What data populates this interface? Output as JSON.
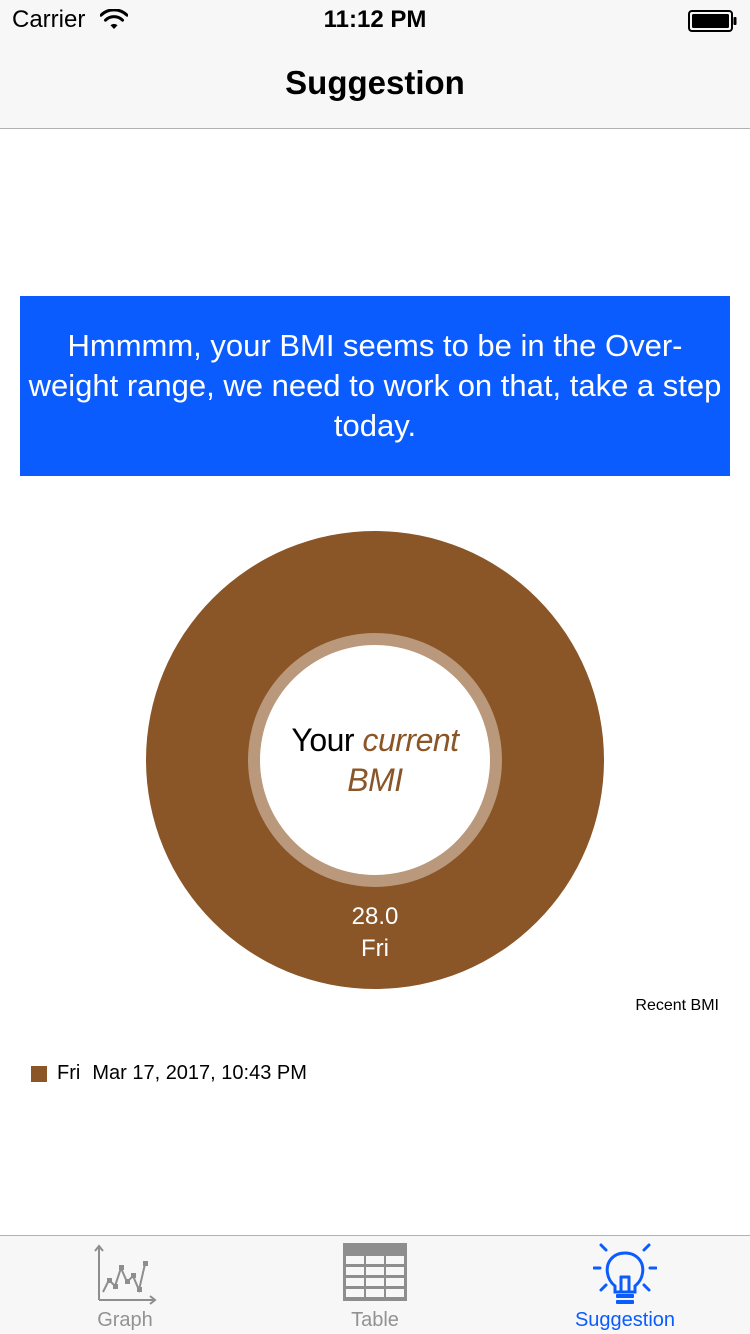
{
  "status_bar": {
    "carrier": "Carrier",
    "time": "11:12 PM",
    "icons": [
      "wifi-icon",
      "battery-icon"
    ]
  },
  "nav": {
    "title": "Suggestion"
  },
  "suggestion": {
    "message": "Hmmmm, your BMI seems to be in the Over-weight range, we need to work on that, take a step today.",
    "background_color": "#0b5cff"
  },
  "chart_data": {
    "type": "pie",
    "categories": [
      "Fri"
    ],
    "values": [
      28.0
    ],
    "value_labels": [
      "28.0"
    ],
    "center_text": {
      "prefix": "Your",
      "emphasis": "current",
      "suffix": "BMI"
    },
    "description": "Recent BMI",
    "legend": {
      "entries": [
        {
          "label": "Fri",
          "date": "Mar 17, 2017, 10:43 PM",
          "color": "#8a5527"
        }
      ],
      "position": "bottom-left"
    },
    "slice_color": "#8a5527",
    "hole_ring_color": "#b9987b"
  },
  "tabs": [
    {
      "label": "Graph",
      "icon": "line-graph-icon",
      "active": false
    },
    {
      "label": "Table",
      "icon": "table-grid-icon",
      "active": false
    },
    {
      "label": "Suggestion",
      "icon": "lightbulb-icon",
      "active": true
    }
  ],
  "colors": {
    "accent": "#0b5cff",
    "inactive_tab": "#929292",
    "bar_background": "#f7f7f7"
  }
}
